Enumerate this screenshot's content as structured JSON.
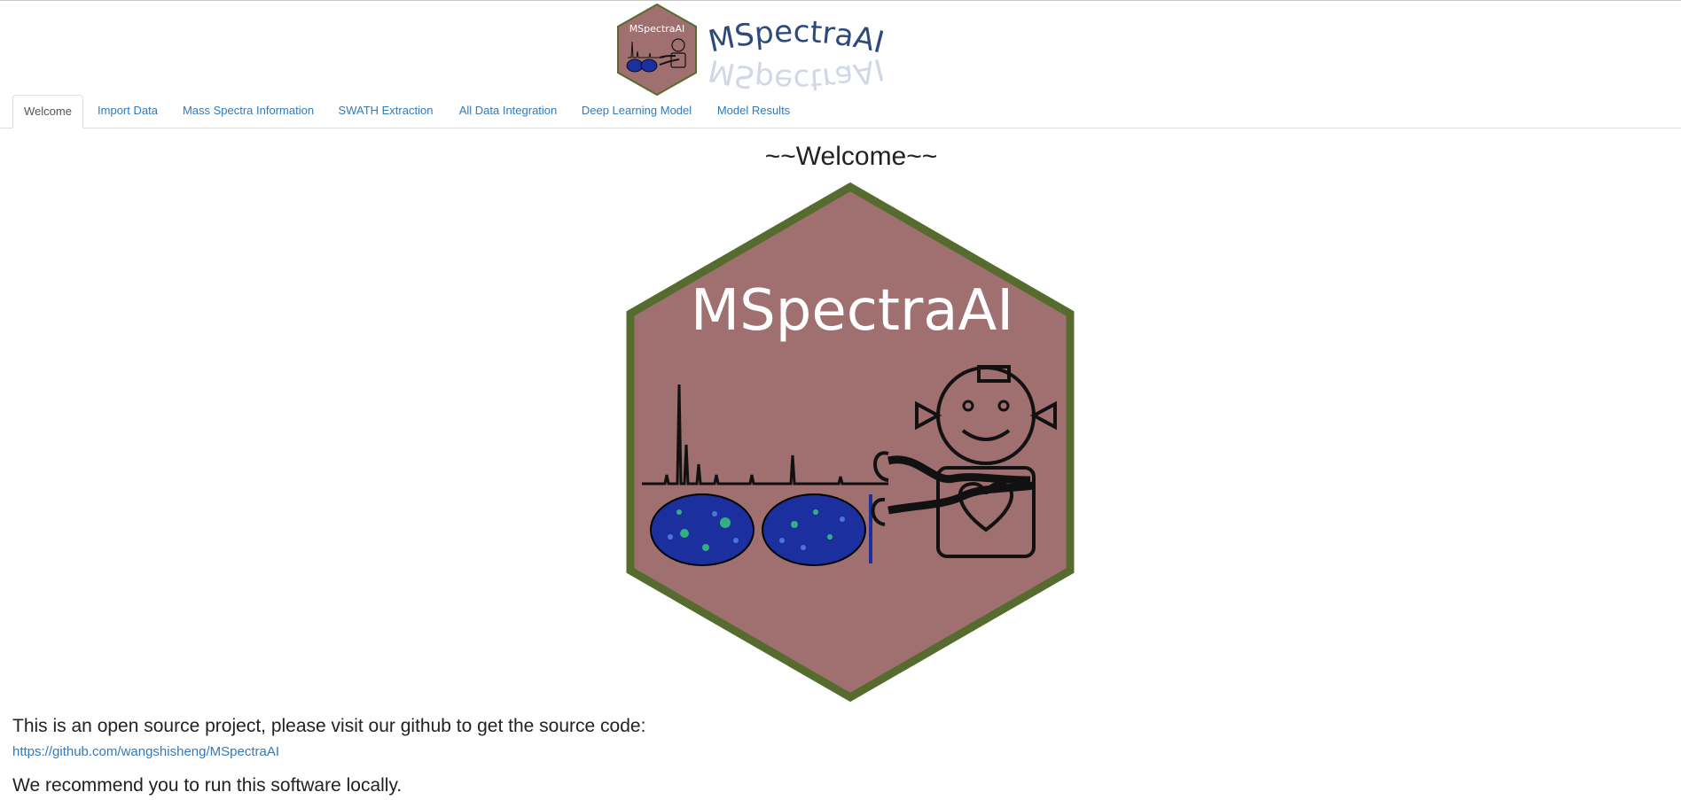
{
  "header": {
    "logo_text": "MSpectraAI",
    "title": "MSpectraAI"
  },
  "tabs": [
    {
      "label": "Welcome",
      "active": true
    },
    {
      "label": "Import Data",
      "active": false
    },
    {
      "label": "Mass Spectra Information",
      "active": false
    },
    {
      "label": "SWATH Extraction",
      "active": false
    },
    {
      "label": "All Data Integration",
      "active": false
    },
    {
      "label": "Deep Learning Model",
      "active": false
    },
    {
      "label": "Model Results",
      "active": false
    }
  ],
  "main": {
    "heading": "~~Welcome~~",
    "logo_text": "MSpectraAI",
    "intro": "This is an open source project, please visit our github to get the source code:",
    "github_link": "https://github.com/wangshisheng/MSpectraAI",
    "recommendation": "We recommend you to run this software locally."
  },
  "colors": {
    "hex_fill": "#a07070",
    "hex_border": "#566b2e",
    "link": "#337ab7",
    "title_blue": "#2e4a7a"
  }
}
